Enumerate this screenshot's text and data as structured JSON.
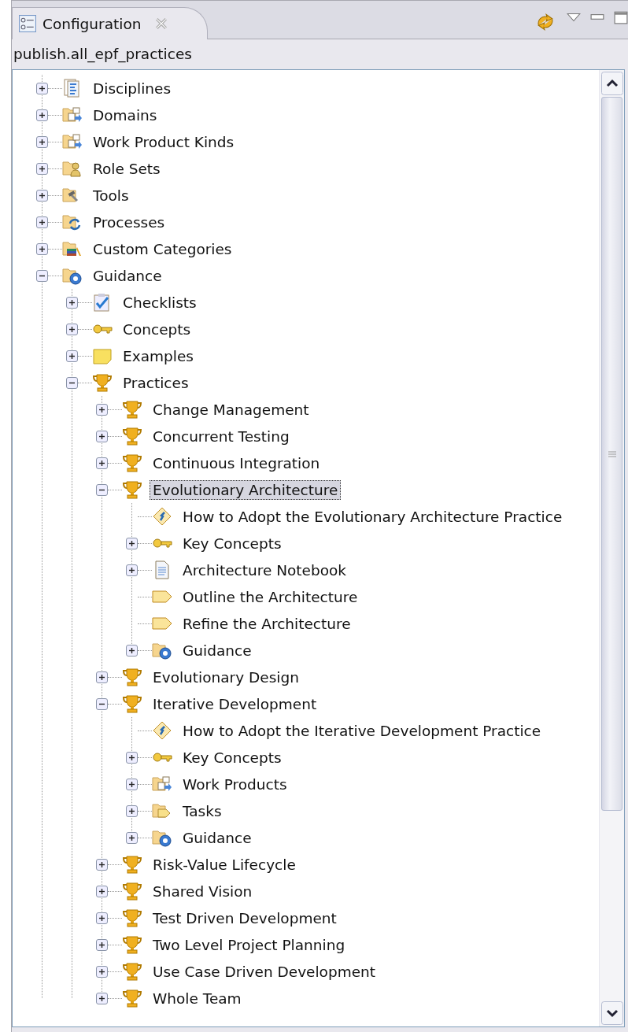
{
  "tab": {
    "title": "Configuration",
    "selected": true
  },
  "breadcrumb": "publish.all_epf_practices",
  "tree": [
    {
      "label": "Disciplines",
      "kind": "disciplines",
      "expanded": false,
      "selected": false
    },
    {
      "label": "Domains",
      "kind": "domain",
      "expanded": false,
      "selected": false
    },
    {
      "label": "Work Product Kinds",
      "kind": "domain",
      "expanded": false,
      "selected": false
    },
    {
      "label": "Role Sets",
      "kind": "roleset",
      "expanded": false,
      "selected": false
    },
    {
      "label": "Tools",
      "kind": "tool",
      "expanded": false,
      "selected": false
    },
    {
      "label": "Processes",
      "kind": "process",
      "expanded": false,
      "selected": false
    },
    {
      "label": "Custom Categories",
      "kind": "custom",
      "expanded": false,
      "selected": false
    },
    {
      "label": "Guidance",
      "kind": "guidance",
      "expanded": true,
      "selected": false,
      "children": [
        {
          "label": "Checklists",
          "kind": "checklist",
          "expanded": false,
          "selected": false
        },
        {
          "label": "Concepts",
          "kind": "concept",
          "expanded": false,
          "selected": false
        },
        {
          "label": "Examples",
          "kind": "example",
          "expanded": false,
          "selected": false
        },
        {
          "label": "Practices",
          "kind": "practice",
          "expanded": true,
          "selected": false,
          "children": [
            {
              "label": "Change Management",
              "kind": "practice",
              "expanded": false,
              "selected": false
            },
            {
              "label": "Concurrent Testing",
              "kind": "practice",
              "expanded": false,
              "selected": false
            },
            {
              "label": "Continuous Integration",
              "kind": "practice",
              "expanded": false,
              "selected": false
            },
            {
              "label": "Evolutionary Architecture",
              "kind": "practice",
              "expanded": true,
              "selected": true,
              "children": [
                {
                  "label": "How to Adopt the Evolutionary Architecture Practice",
                  "kind": "roadmap",
                  "selected": false
                },
                {
                  "label": "Key Concepts",
                  "kind": "concept",
                  "expanded": false,
                  "selected": false
                },
                {
                  "label": "Architecture Notebook",
                  "kind": "artifact",
                  "expanded": false,
                  "selected": false
                },
                {
                  "label": "Outline the Architecture",
                  "kind": "task",
                  "selected": false
                },
                {
                  "label": "Refine the Architecture",
                  "kind": "task",
                  "selected": false
                },
                {
                  "label": "Guidance",
                  "kind": "guidance",
                  "expanded": false,
                  "selected": false
                }
              ]
            },
            {
              "label": "Evolutionary Design",
              "kind": "practice",
              "expanded": false,
              "selected": false
            },
            {
              "label": "Iterative Development",
              "kind": "practice",
              "expanded": true,
              "selected": false,
              "children": [
                {
                  "label": "How to Adopt the Iterative Development Practice",
                  "kind": "roadmap",
                  "selected": false
                },
                {
                  "label": "Key Concepts",
                  "kind": "concept",
                  "expanded": false,
                  "selected": false
                },
                {
                  "label": "Work Products",
                  "kind": "domain",
                  "expanded": false,
                  "selected": false
                },
                {
                  "label": "Tasks",
                  "kind": "tasks",
                  "expanded": false,
                  "selected": false
                },
                {
                  "label": "Guidance",
                  "kind": "guidance",
                  "expanded": false,
                  "selected": false
                }
              ]
            },
            {
              "label": "Risk-Value Lifecycle",
              "kind": "practice",
              "expanded": false,
              "selected": false
            },
            {
              "label": "Shared Vision",
              "kind": "practice",
              "expanded": false,
              "selected": false
            },
            {
              "label": "Test Driven Development",
              "kind": "practice",
              "expanded": false,
              "selected": false
            },
            {
              "label": "Two Level Project Planning",
              "kind": "practice",
              "expanded": false,
              "selected": false
            },
            {
              "label": "Use Case Driven Development",
              "kind": "practice",
              "expanded": false,
              "selected": false
            },
            {
              "label": "Whole Team",
              "kind": "practice",
              "expanded": false,
              "selected": false
            }
          ]
        }
      ]
    }
  ]
}
